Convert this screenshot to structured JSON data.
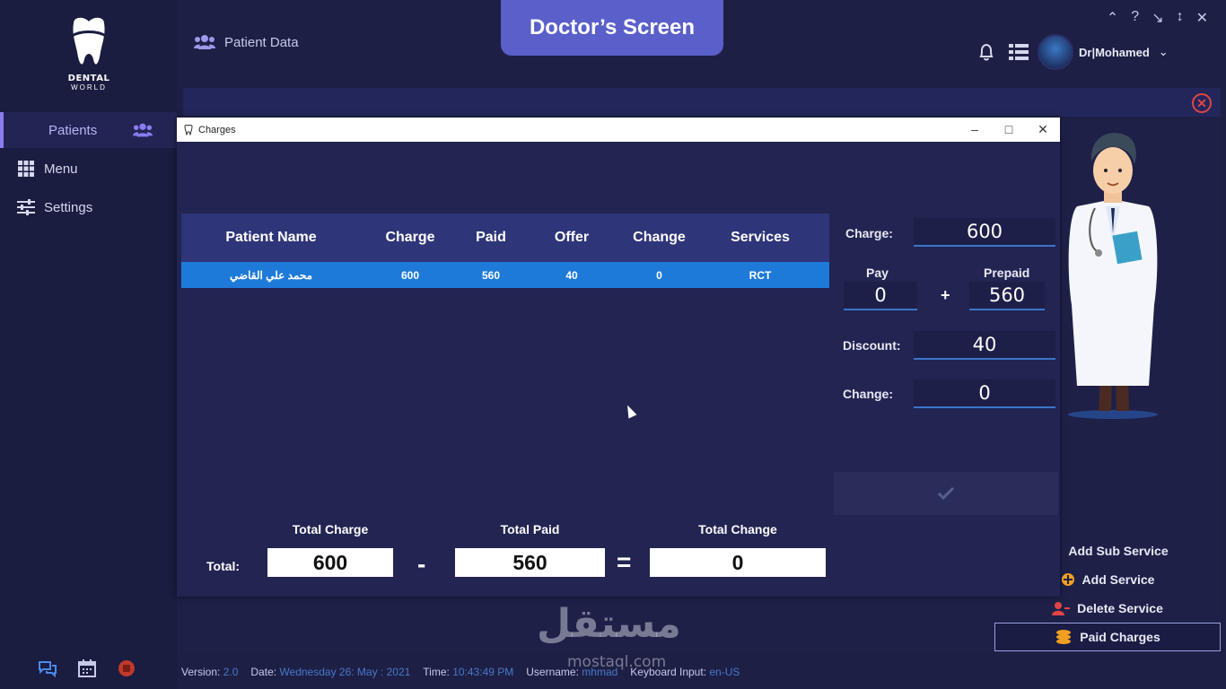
{
  "app": {
    "logo_text": "DENTAL",
    "logo_sub": "WORLD"
  },
  "header": {
    "breadcrumb": "Patient Data",
    "screen_title": "Doctor’s Screen",
    "user_name": "Dr|Mohamed"
  },
  "sidebar": {
    "items": [
      {
        "label": "Patients",
        "icon": "users-icon"
      },
      {
        "label": "Menu",
        "icon": "grid-icon"
      },
      {
        "label": "Settings",
        "icon": "sliders-icon"
      }
    ]
  },
  "dialog": {
    "title": "Charges",
    "columns": [
      "Patient Name",
      "Charge",
      "Paid",
      "Offer",
      "Change",
      "Services"
    ],
    "rows": [
      {
        "name": "محمد علي القاضي",
        "charge": "600",
        "paid": "560",
        "offer": "40",
        "change": "0",
        "services": "RCT"
      }
    ],
    "form": {
      "charge_label": "Charge:",
      "charge_value": "600",
      "pay_label": "Pay",
      "pay_value": "0",
      "prepaid_label": "Prepaid",
      "prepaid_value": "560",
      "plus": "+",
      "discount_label": "Discount:",
      "discount_value": "40",
      "change_label": "Change:",
      "change_value": "0"
    },
    "totals": {
      "total_label": "Total:",
      "total_charge_label": "Total Charge",
      "total_charge": "600",
      "total_paid_label": "Total Paid",
      "total_paid": "560",
      "total_change_label": "Total Change",
      "total_change": "0",
      "minus": "-",
      "equals": "="
    }
  },
  "actions": {
    "add_sub_service": "Add Sub Service",
    "add_service": "Add Service",
    "delete_service": "Delete Service",
    "paid_charges": "Paid Charges"
  },
  "status": {
    "version_label": "Version:",
    "version": "2.0",
    "date_label": "Date:",
    "date": "Wednesday  26: May : 2021",
    "time_label": "Time:",
    "time": "10:43:49 PM",
    "username_label": "Username:",
    "username": "mhmad",
    "keyboard_label": "Keyboard Input:",
    "keyboard": "en-US"
  },
  "watermark": {
    "main": "مستقل",
    "sub": "mostaql.com"
  },
  "colors": {
    "accent": "#5a5fc9",
    "row_selected": "#1e7ad8",
    "header_row": "#2e3579",
    "danger": "#e04545"
  }
}
